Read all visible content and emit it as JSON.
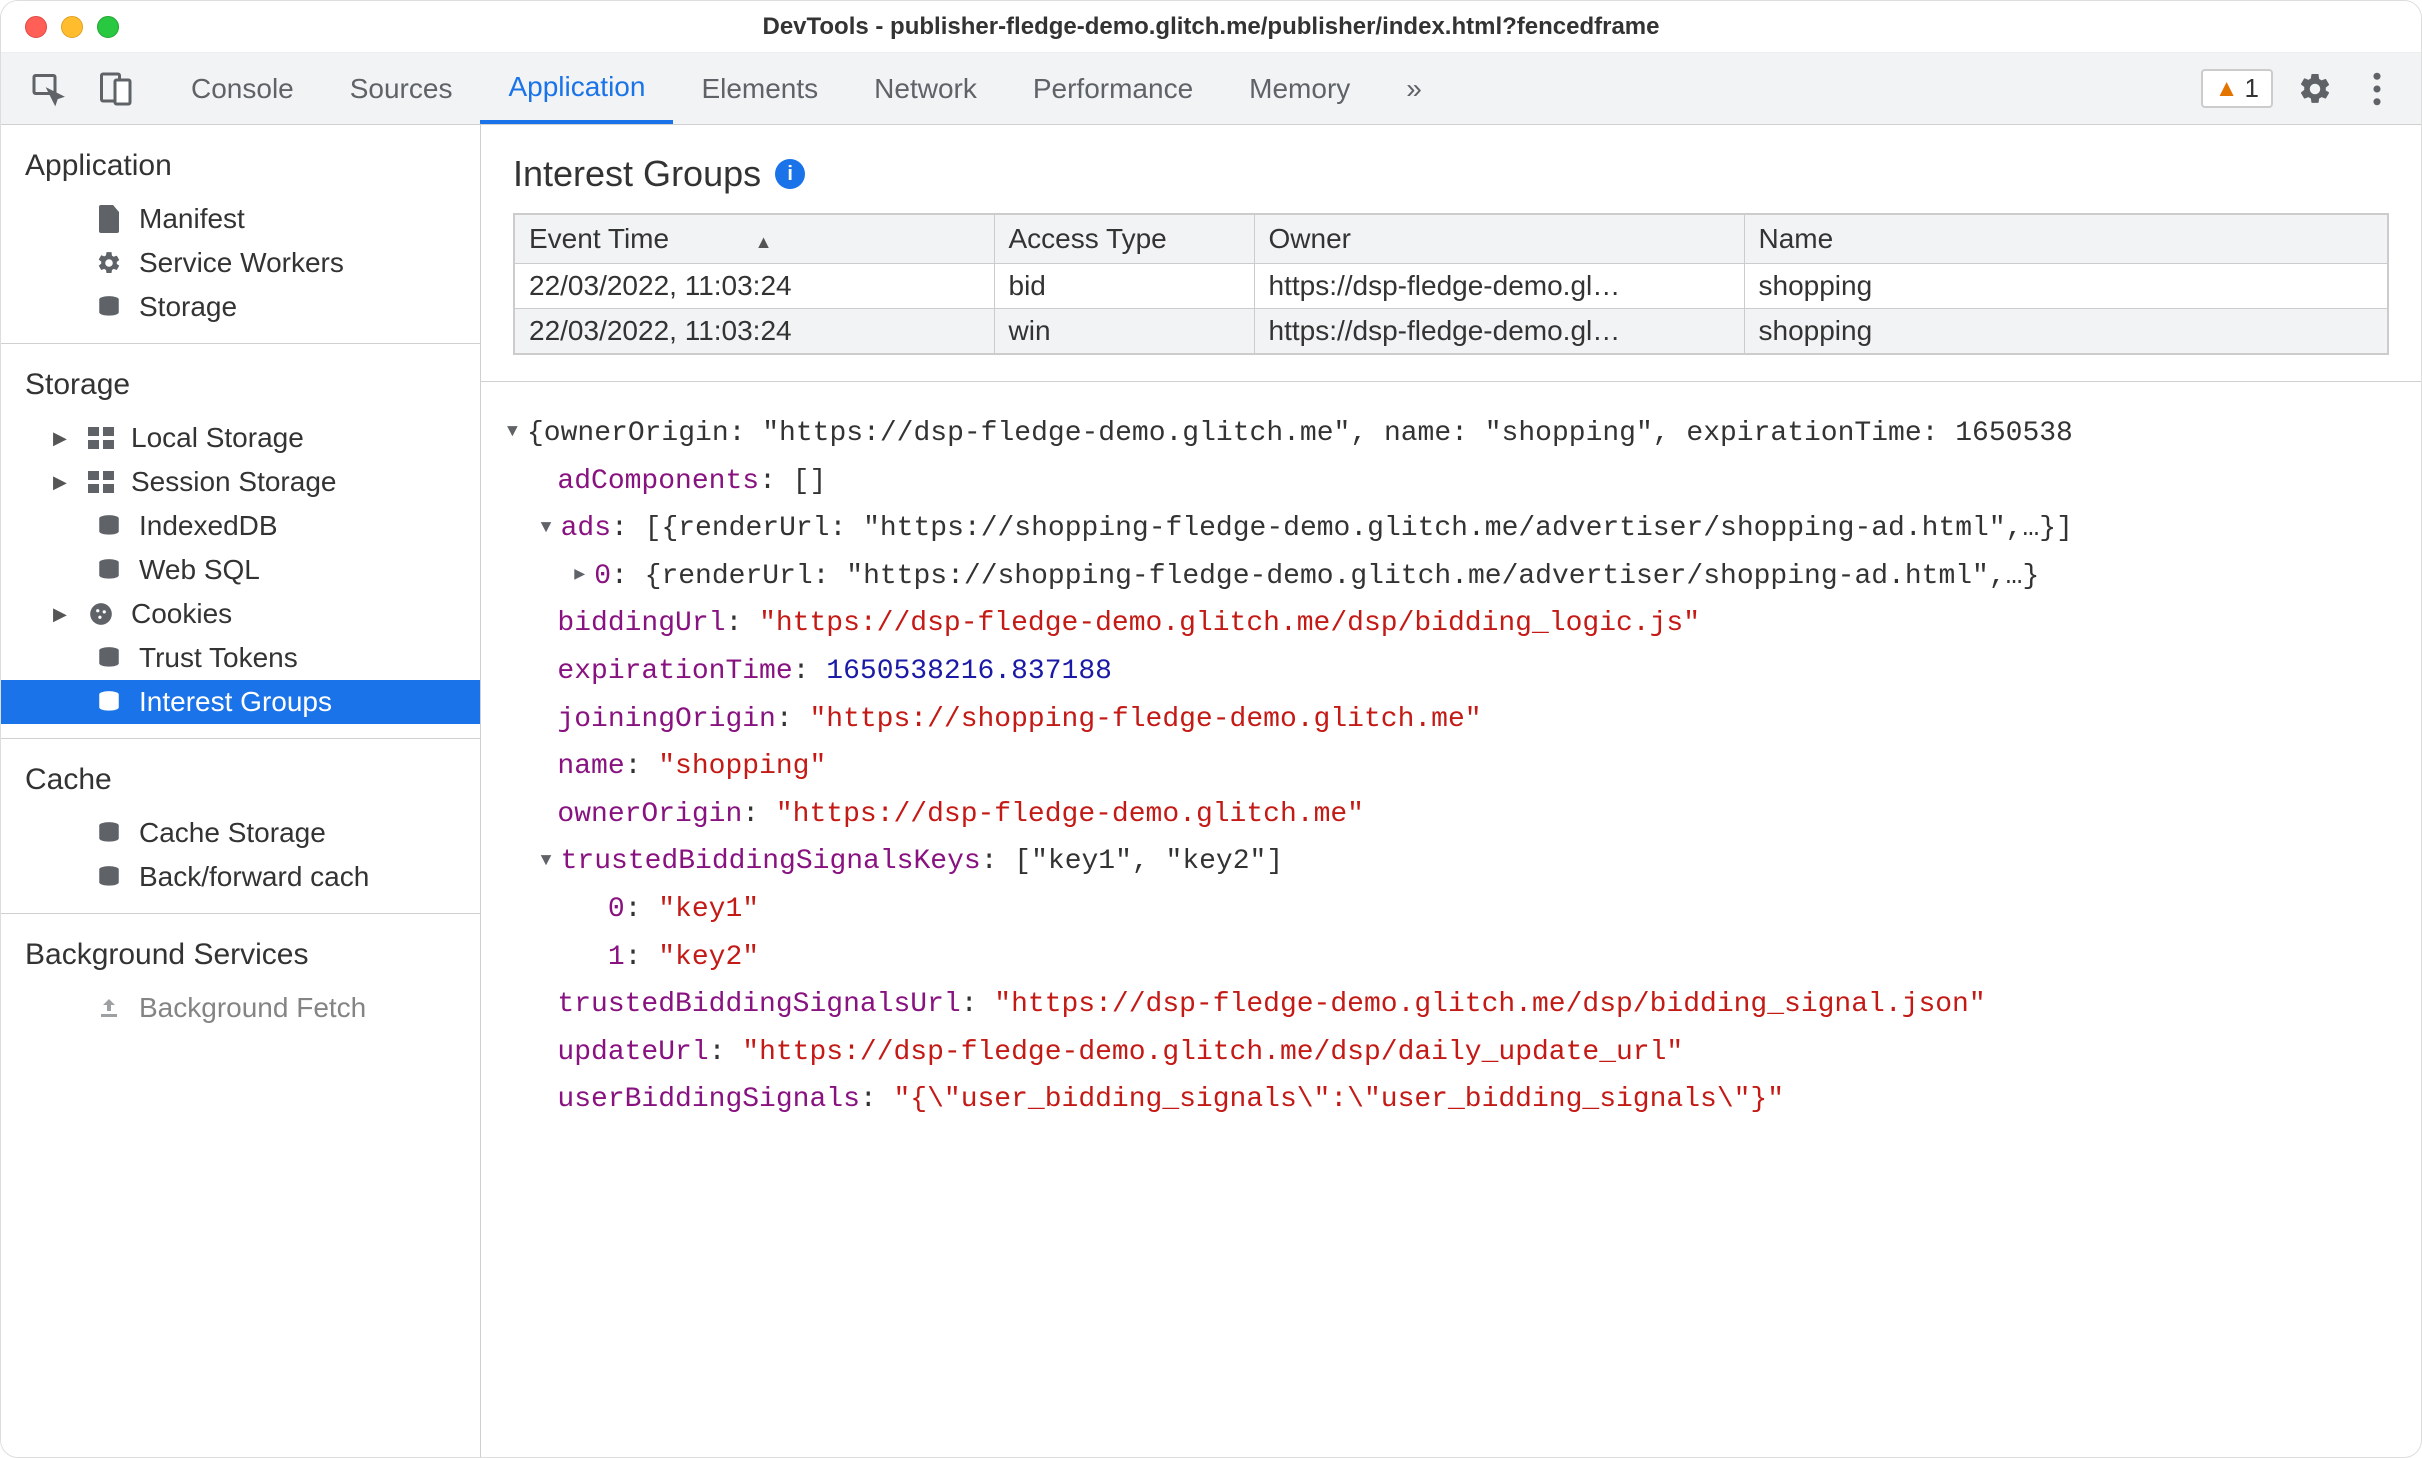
{
  "window": {
    "title": "DevTools - publisher-fledge-demo.glitch.me/publisher/index.html?fencedframe"
  },
  "toolbar": {
    "tabs": [
      "Console",
      "Sources",
      "Application",
      "Elements",
      "Network",
      "Performance",
      "Memory"
    ],
    "active": "Application",
    "more": "»",
    "warning_count": "1"
  },
  "sidebar": {
    "application": {
      "header": "Application",
      "items": [
        "Manifest",
        "Service Workers",
        "Storage"
      ]
    },
    "storage": {
      "header": "Storage",
      "items": [
        "Local Storage",
        "Session Storage",
        "IndexedDB",
        "Web SQL",
        "Cookies",
        "Trust Tokens",
        "Interest Groups"
      ]
    },
    "cache": {
      "header": "Cache",
      "items": [
        "Cache Storage",
        "Back/forward cach"
      ]
    },
    "background": {
      "header": "Background Services",
      "items": [
        "Background Fetch"
      ]
    }
  },
  "panel": {
    "title": "Interest Groups",
    "columns": [
      "Event Time",
      "Access Type",
      "Owner",
      "Name"
    ],
    "rows": [
      {
        "time": "22/03/2022, 11:03:24",
        "type": "bid",
        "owner": "https://dsp-fledge-demo.gl…",
        "name": "shopping"
      },
      {
        "time": "22/03/2022, 11:03:24",
        "type": "win",
        "owner": "https://dsp-fledge-demo.gl…",
        "name": "shopping"
      }
    ]
  },
  "detail": {
    "summary_plain": "{ownerOrigin: \"https://dsp-fledge-demo.glitch.me\", name: \"shopping\", expirationTime: 1650538",
    "adComponents": {
      "key": "adComponents",
      "val": "[]"
    },
    "ads_summary_plain": "[{renderUrl: \"https://shopping-fledge-demo.glitch.me/advertiser/shopping-ad.html\",…}]",
    "ads_0_plain": "{renderUrl: \"https://shopping-fledge-demo.glitch.me/advertiser/shopping-ad.html\",…}",
    "biddingUrl": "\"https://dsp-fledge-demo.glitch.me/dsp/bidding_logic.js\"",
    "expirationTime": "1650538216.837188",
    "joiningOrigin": "\"https://shopping-fledge-demo.glitch.me\"",
    "name": "\"shopping\"",
    "ownerOrigin": "\"https://dsp-fledge-demo.glitch.me\"",
    "tbsk_summary": "[\"key1\", \"key2\"]",
    "tbsk_0": "\"key1\"",
    "tbsk_1": "\"key2\"",
    "trustedBiddingSignalsUrl": "\"https://dsp-fledge-demo.glitch.me/dsp/bidding_signal.json\"",
    "updateUrl": "\"https://dsp-fledge-demo.glitch.me/dsp/daily_update_url\"",
    "userBiddingSignals": "\"{\\\"user_bidding_signals\\\":\\\"user_bidding_signals\\\"}\"",
    "labels": {
      "ads": "ads",
      "zero": "0",
      "one": "1",
      "biddingUrl": "biddingUrl",
      "expirationTime": "expirationTime",
      "joiningOrigin": "joiningOrigin",
      "name": "name",
      "ownerOrigin": "ownerOrigin",
      "trustedBiddingSignalsKeys": "trustedBiddingSignalsKeys",
      "trustedBiddingSignalsUrl": "trustedBiddingSignalsUrl",
      "updateUrl": "updateUrl",
      "userBiddingSignals": "userBiddingSignals"
    }
  }
}
